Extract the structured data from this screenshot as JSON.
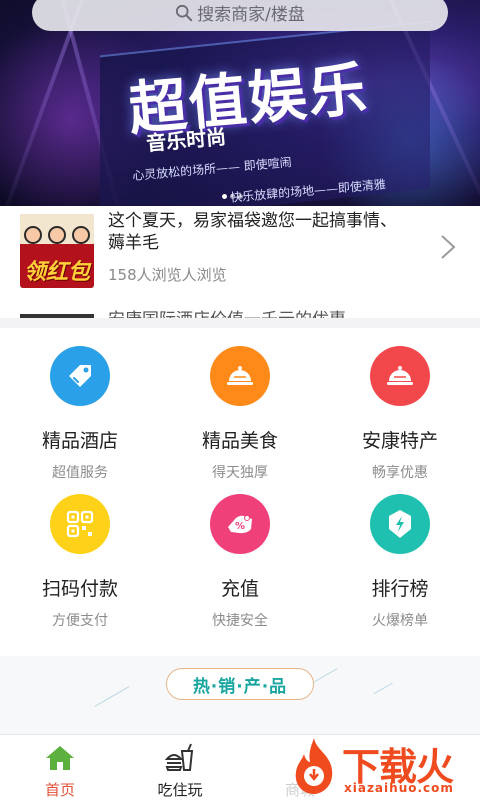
{
  "search": {
    "placeholder": "搜索商家/楼盘",
    "icon": "search-icon"
  },
  "banner": {
    "title": "超值娱乐",
    "subtitle": "音乐时尚",
    "line1": "心灵放松的场所—— 即使喧闹",
    "line2": "快乐放肆的场地——即使清雅",
    "slides": 3,
    "active_slide": 1
  },
  "news": {
    "items": [
      {
        "title": "这个夏天，易家福袋邀您一起搞事情、薅羊毛",
        "views": "158人浏览人浏览",
        "thumb_text": "领红包"
      },
      {
        "title": "安康国际酒店价值一千元的优惠",
        "views": ""
      }
    ]
  },
  "services": [
    {
      "label": "精品酒店",
      "sub": "超值服务",
      "color": "#2aa0e8",
      "icon": "tag-icon"
    },
    {
      "label": "精品美食",
      "sub": "得天独厚",
      "color": "#ff8a1a",
      "icon": "food-cover-icon"
    },
    {
      "label": "安康特产",
      "sub": "畅享优惠",
      "color": "#f2474b",
      "icon": "food-cover-icon"
    },
    {
      "label": "扫码付款",
      "sub": "方便支付",
      "color": "#ffd21a",
      "icon": "qr-code-icon"
    },
    {
      "label": "充值",
      "sub": "快捷安全",
      "color": "#f0407a",
      "icon": "discount-wallet-icon"
    },
    {
      "label": "排行榜",
      "sub": "火爆榜单",
      "color": "#1fc0b0",
      "icon": "lightning-icon"
    }
  ],
  "hot": {
    "title": "热·销·产·品"
  },
  "tabbar": {
    "tabs": [
      {
        "label": "首页",
        "icon": "home-icon",
        "active": true
      },
      {
        "label": "吃住玩",
        "icon": "drink-burger-icon",
        "active": false
      },
      {
        "label": "商城",
        "icon": "shop-icon",
        "active": false
      }
    ]
  },
  "watermark": {
    "text": "下载火",
    "sub": "xiazaihuo.com"
  }
}
